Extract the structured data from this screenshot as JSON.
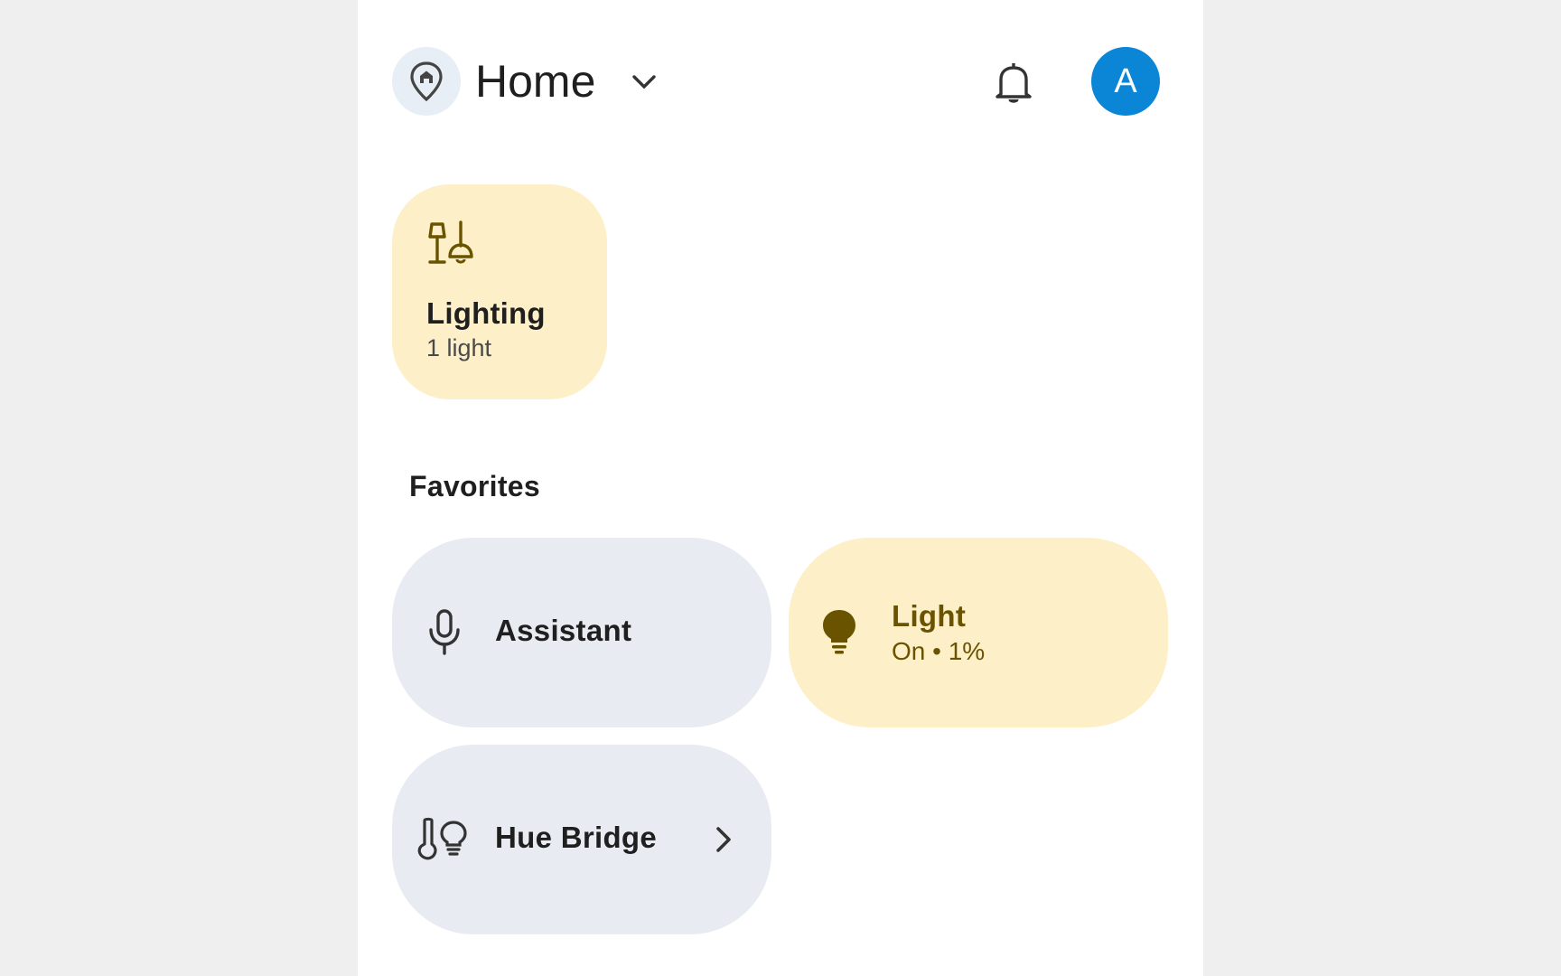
{
  "header": {
    "title": "Home",
    "home_icon": "home-pin-icon",
    "dropdown_icon": "chevron-down-icon",
    "notifications_icon": "bell-icon",
    "avatar_initial": "A",
    "avatar_color": "#0b86d6"
  },
  "categories": [
    {
      "icon": "lamp-icon",
      "title": "Lighting",
      "subtitle": "1 light",
      "color": "#fdefc8"
    }
  ],
  "favorites": {
    "heading": "Favorites",
    "tiles": [
      {
        "icon": "microphone-icon",
        "label": "Assistant",
        "color": "#e8ecf2"
      },
      {
        "icon": "lightbulb-icon",
        "label": "Light",
        "status": "On • 1%",
        "color": "#fdefc8"
      },
      {
        "icon": "sensor-bulb-icon",
        "label": "Hue Bridge",
        "trailing_icon": "chevron-right-icon",
        "color": "#e8ecf2"
      }
    ]
  },
  "colors": {
    "background": "#efefef",
    "surface": "#ffffff",
    "accent_yellow_text": "#6a5300"
  }
}
